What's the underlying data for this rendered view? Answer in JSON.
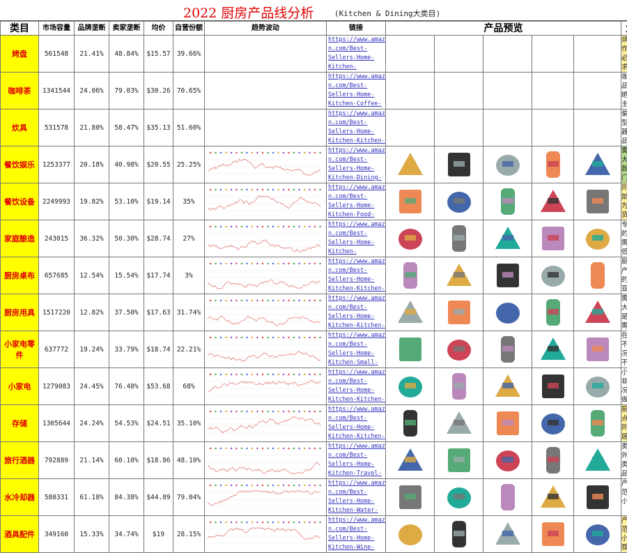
{
  "title": {
    "main": "2022 厨房产品线分析",
    "sub": "(Kitchen & Dining大类目)"
  },
  "headers": {
    "category": "类目",
    "market": "市场容量",
    "brand_mono": "品牌垄断",
    "seller_mono": "卖家垄断",
    "avg_price": "均价",
    "self_share": "自营份额",
    "trend": "趋势波动",
    "link": "链接",
    "preview": "产品预览",
    "big": "大类"
  },
  "colors": {
    "category_bg": "#ffff00",
    "category_text": "#e00000",
    "link": "#3030c0",
    "note_yellow": "#fff2a0",
    "note_green": "#b5d98a"
  },
  "rows": [
    {
      "cat": "烤盘",
      "market": "561548",
      "brand": "21.41%",
      "seller": "48.84%",
      "price": "$15.57",
      "self": "39.66%",
      "link": "https://www.amazo\nn.com/Best-\nSellers-Home-\nKitchen-",
      "note": "烘培产品作为厨房必需且需求较高的",
      "note_color": "yellow",
      "has_trend": false,
      "icons": []
    },
    {
      "cat": "咖啡茶",
      "market": "1341544",
      "brand": "24.06%",
      "seller": "79.03%",
      "price": "$30.26",
      "self": "70.65%",
      "link": "https://www.amazo\nn.com/Best-\nSellers-Home-\nKitchen-Coffee-",
      "note": "咖啡茶产品类目,绝大多数主要售卖",
      "note_color": "none",
      "has_trend": false,
      "icons": []
    },
    {
      "cat": "炊具",
      "market": "531578",
      "brand": "21.80%",
      "seller": "58.47%",
      "price": "$35.13",
      "self": "51.60%",
      "link": "https://www.amazo\nn.com/Best-\nSellers-Home-\nKitchen-Kitchen-",
      "note": "偏较大体型或者机器型的产品,单价",
      "note_color": "none",
      "has_trend": false,
      "icons": []
    },
    {
      "cat": "餐饮娱乐",
      "market": "1253377",
      "brand": "20.18%",
      "seller": "40.98%",
      "price": "$20.55",
      "self": "25.25%",
      "link": "https://www.amazo\nn.com/Best-\nSellers-Home-\nKitchen-Dining-",
      "note": "需求量大,产品款式多,门槛偏",
      "note_color": "green",
      "has_trend": true,
      "icons": [
        "nesting-bowls-icon",
        "baking-sheets-icon",
        "silicone-cupcake-liners-icon",
        "kitchen-torch-icon",
        "pizza-cutter-icon"
      ]
    },
    {
      "cat": "餐饮设备",
      "market": "2249993",
      "brand": "19.82%",
      "seller": "53.10%",
      "price": "$19.14",
      "self": "35%",
      "link": "https://www.amazo\nn.com/Best-\nSellers-Home-\nKitchen-Food-",
      "note": "同上,虽部分产品为较难发货销售的",
      "note_color": "yellow",
      "has_trend": true,
      "icons": [
        "coffee-bag-icon",
        "coffee-pods-box-icon",
        "electric-kettle-icon",
        "k-cups-icon",
        "tea-box-icon"
      ]
    },
    {
      "cat": "家庭酿造",
      "market": "243015",
      "brand": "36.32%",
      "seller": "50.30%",
      "price": "$28.74",
      "self": "27%",
      "link": "https://www.amazo\nn.com/Best-\nSellers-Home-\nKitchen-",
      "note": "专为酿酒的类目,需求量较低,目前",
      "note_color": "none",
      "has_trend": true,
      "icons": [
        "cast-iron-skillet-icon",
        "egg-rings-icon",
        "tea-kettle-icon",
        "griddle-icon",
        "air-fryer-icon"
      ]
    },
    {
      "cat": "厨房桌布",
      "market": "657685",
      "brand": "12.54%",
      "seller": "15.54%",
      "price": "$17.74",
      "self": "3%",
      "link": "https://www.amazo\nn.com/Best-\nSellers-Home-\nKitchen-Kitchen-",
      "note": "厨房布类产品集中的类目,亚马逊垄",
      "note_color": "none",
      "has_trend": true,
      "icons": [
        "tumbler-icon",
        "apron-icon",
        "dish-towels-icon",
        "cutting-board-icon",
        "dish-rack-icon"
      ]
    },
    {
      "cat": "厨房用具",
      "market": "1517220",
      "brand": "12.82%",
      "seller": "37.50%",
      "price": "$17.63",
      "self": "31.74%",
      "link": "https://www.amazo\nn.com/Best-\nSellers-Home-\nKitchen-Kitchen-",
      "note": "需求量大,且都是厨房必需品,上",
      "note_color": "none",
      "has_trend": true,
      "icons": [
        "paper-towels-icon",
        "gloves-box-icon",
        "kitchen-shears-icon",
        "salt-pepper-grinder-icon",
        "food-covers-icon"
      ]
    },
    {
      "cat": "小家电零件",
      "market": "637772",
      "brand": "19.24%",
      "seller": "33.79%",
      "price": "$18.74",
      "self": "22.21%",
      "link": "https://www.amazo\nn.com/Best-\nSellers-Home-\nKitchen-Small-",
      "note": "在小家电不做的情况下,并不太优先",
      "note_color": "none",
      "has_trend": true,
      "icons": [
        "infrared-thermometer-icon",
        "amber-bottles-icon",
        "coffee-filter-icon",
        "mesh-strainer-icon",
        "coffee-filters-icon"
      ]
    },
    {
      "cat": "小家电",
      "market": "1279083",
      "brand": "24.45%",
      "seller": "76.48%",
      "price": "$53.68",
      "self": "68%",
      "link": "https://www.amazo\nn.com/Best-\nSellers-Home-\nKitchen-Kitchen-",
      "note": "小家电在非必要情况下不做,除非",
      "note_color": "none",
      "has_trend": true,
      "icons": [
        "sponges-icon",
        "apron-icon",
        "tablecloth-icon",
        "kitchen-mat-icon",
        "oven-mitts-icon"
      ]
    },
    {
      "cat": "存储",
      "market": "1305644",
      "brand": "24.24%",
      "seller": "54.53%",
      "price": "$24.51",
      "self": "35.10%",
      "link": "https://www.amazo\nn.com/Best-\nSellers-Home-\nKitchen-Kitchen-",
      "note": "厨房类重点类目,同部分家居收纳类",
      "note_color": "yellow",
      "has_trend": true,
      "icons": [
        "meat-thermometer-icon",
        "ice-cube-trays-icon",
        "knife-sharpener-icon",
        "vegetable-chopper-icon",
        "knife-sharpener-tool-icon"
      ]
    },
    {
      "cat": "旅行酒器",
      "market": "792889",
      "brand": "21.14%",
      "seller": "60.10%",
      "price": "$18.86",
      "self": "48.10%",
      "link": "https://www.amazo\nn.com/Best-\nSellers-Home-\nKitchen-Travel-",
      "note": "类目同户外的水瓶类目,产品及其相",
      "note_color": "none",
      "has_trend": true,
      "icons": [
        "cleaner-bottles-icon",
        "k-cup-carousel-icon",
        "blender-icon",
        "espresso-machine-icon",
        "reusable-k-cups-icon"
      ]
    },
    {
      "cat": "水冷却器",
      "market": "580331",
      "brand": "61.18%",
      "seller": "84.38%",
      "price": "$44.89",
      "self": "79.04%",
      "link": "https://www.amazo\nn.com/Best-\nSellers-Home-\nKitchen-Water-",
      "note": "产品适用范围较小,不做;",
      "note_color": "none",
      "has_trend": true,
      "icons": [
        "water-bottles-icon",
        "sandwich-maker-icon",
        "egg-cooker-icon",
        "pressure-cooker-icon",
        "microwave-icon"
      ]
    },
    {
      "cat": "酒具配件",
      "market": "349160",
      "brand": "15.33%",
      "seller": "34.74%",
      "price": "$19",
      "self": "28.15%",
      "link": "https://www.amazo\nn.com/Best-\nSellers-Home-\nKitchen-Wine-",
      "note": "产品适用范围较小,不推荐优先专",
      "note_color": "yellow",
      "has_trend": true,
      "icons": [
        "insulated-bottles-icon",
        "bento-box-icon",
        "cooler-bag-icon",
        "glass-cutting-board-icon",
        "wine-glass-charms-icon"
      ]
    }
  ]
}
